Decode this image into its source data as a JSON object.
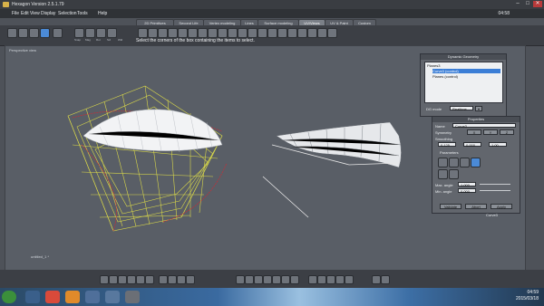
{
  "window": {
    "title": "Hexagon Version 2.5.1.79",
    "minimize": "–",
    "maximize": "□",
    "close": "✕"
  },
  "menubar": {
    "items": [
      "File",
      "Edit",
      "View",
      "Display",
      "Selection",
      "Tools",
      "Help"
    ],
    "clock": "04:58"
  },
  "tabs": [
    "2D Primitives",
    "Second Life",
    "Vertex modeling",
    "Lines",
    "Surface modeling",
    "UV/Views",
    "UV & Paint",
    "Custom"
  ],
  "toolbar": {
    "group_labels": [
      "Snap",
      "Mag",
      "Rot",
      "Scl",
      "Wld"
    ],
    "hint": "Select the corners of the box containing the items to select."
  },
  "viewport": {
    "label": "Perspective view",
    "document_name": "untitled_1 *"
  },
  "dynamic_geometry": {
    "title": "Dynamic Geometry",
    "items": [
      "Planes3",
      "Curve3 (control)",
      "Planes (control)"
    ],
    "selected_index": 1,
    "mode_label": "DG mode",
    "mode_value": "Realtime"
  },
  "properties": {
    "title": "Properties",
    "name_label": "Name",
    "name_value": "Curve3",
    "symmetry_label": "Symmetry",
    "axes": [
      "X",
      "Y",
      "Z"
    ],
    "smoothing_label": "Smoothing",
    "smoothing_values": [
      "0.125",
      "0.000",
      "1.00"
    ],
    "mode_label": "Parameters",
    "max_angle_label": "Max. angle",
    "max_angle_value": "1.000",
    "min_angle_label": "Min. angle",
    "min_angle_value": "0.000",
    "buttons": [
      "Validate",
      "Abort",
      "Apply"
    ],
    "footer": "Curve3"
  },
  "taskbar": {
    "time": "04:59",
    "date": "2015/03/18"
  },
  "colors": {
    "viewport": "#595e66",
    "wire_yellow": "#d9d84a",
    "selection": "#3b7ed6",
    "red_curve": "#c0303a"
  }
}
